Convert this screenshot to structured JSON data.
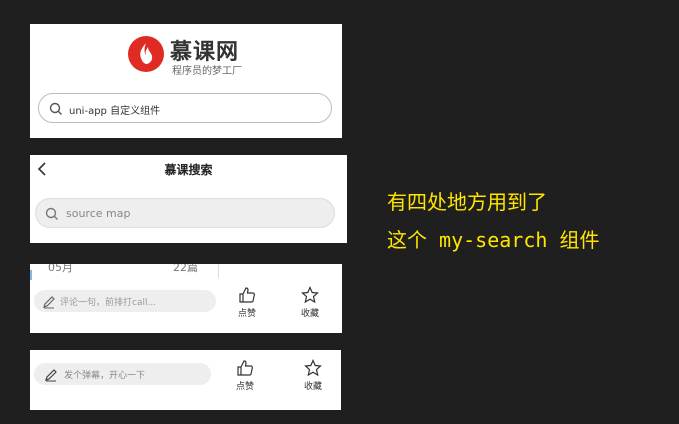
{
  "panel1": {
    "brand": "慕课网",
    "slogan": "程序员的梦工厂",
    "search_placeholder": "uni-app 自定义组件"
  },
  "panel2": {
    "title": "慕课搜索",
    "search_placeholder": "source map"
  },
  "panel3": {
    "cut_left": "05月",
    "cut_right": "22篇",
    "comment_placeholder": "评论一句，前排打call...",
    "like_label": "点赞",
    "fav_label": "收藏"
  },
  "panel4": {
    "comment_placeholder": "发个弹幕，开心一下",
    "like_label": "点赞",
    "fav_label": "收藏"
  },
  "caption": {
    "line1": "有四处地方用到了",
    "line2": "这个 my-search 组件"
  },
  "colors": {
    "background": "#1f1f1f",
    "caption": "#ffe500",
    "brand_red": "#e02a24"
  }
}
